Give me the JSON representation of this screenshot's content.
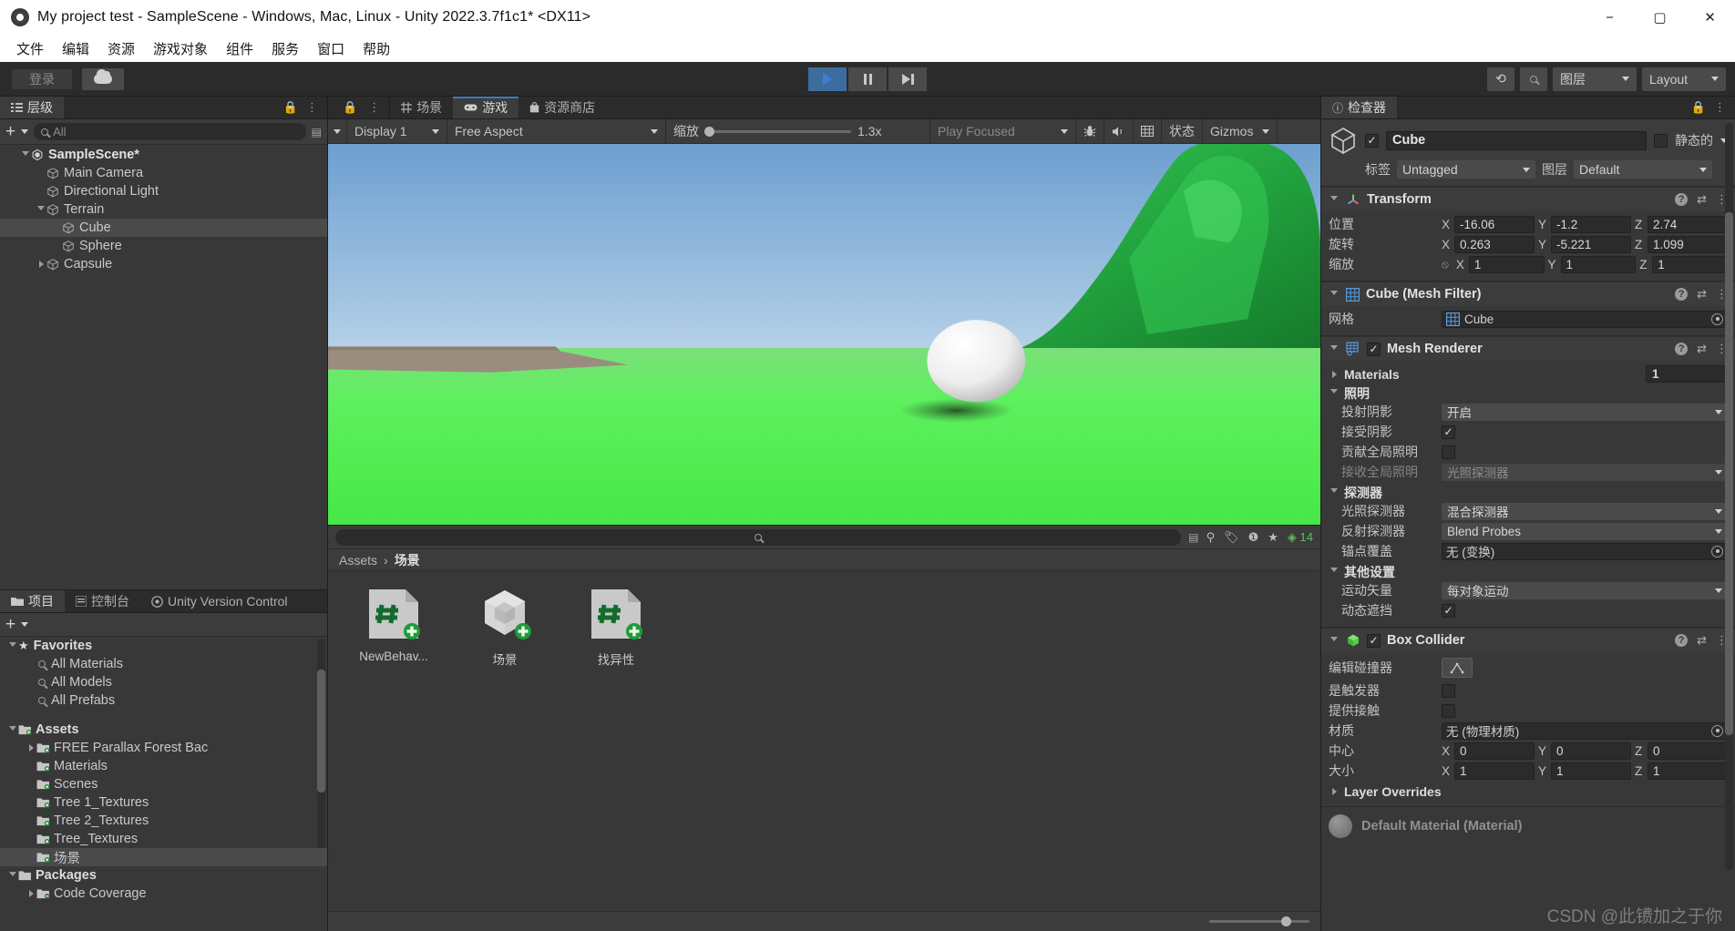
{
  "window": {
    "title": "My project test - SampleScene - Windows, Mac, Linux - Unity 2022.3.7f1c1* <DX11>",
    "app_icon": "unity-logo-icon",
    "minimize": "−",
    "maximize": "▢",
    "close": "✕"
  },
  "menubar": {
    "items": [
      {
        "label": "文件"
      },
      {
        "label": "编辑"
      },
      {
        "label": "资源"
      },
      {
        "label": "游戏对象"
      },
      {
        "label": "组件"
      },
      {
        "label": "服务"
      },
      {
        "label": "窗口"
      },
      {
        "label": "帮助"
      }
    ]
  },
  "toolbar": {
    "login_label": "登录",
    "cloud_icon": "cloud-icon",
    "play_icon": "play-icon",
    "pause_icon": "pause-icon",
    "step_icon": "step-icon",
    "history_icon": "undo-history-icon",
    "search_icon": "search-icon",
    "layers_label": "图层",
    "layout_label": "Layout"
  },
  "hierarchy": {
    "tab_label": "层级",
    "tab_icon": "hierarchy-icon",
    "lock_icon": "lock-icon",
    "menu_icon": "kebab-menu-icon",
    "add_label": "+",
    "search_placeholder": "All",
    "search_icon": "search-icon",
    "items": [
      {
        "label": "SampleScene*",
        "depth": 0,
        "icon": "unity-scene-icon",
        "expanded": true,
        "selected": false,
        "bold": true
      },
      {
        "label": "Main Camera",
        "depth": 1,
        "icon": "gameobject-icon",
        "expanded": null,
        "selected": false,
        "bold": false
      },
      {
        "label": "Directional Light",
        "depth": 1,
        "icon": "gameobject-icon",
        "expanded": null,
        "selected": false,
        "bold": false
      },
      {
        "label": "Terrain",
        "depth": 1,
        "icon": "gameobject-icon",
        "expanded": true,
        "selected": false,
        "bold": false
      },
      {
        "label": "Cube",
        "depth": 2,
        "icon": "gameobject-icon",
        "expanded": null,
        "selected": true,
        "bold": false
      },
      {
        "label": "Sphere",
        "depth": 2,
        "icon": "gameobject-icon",
        "expanded": null,
        "selected": false,
        "bold": false
      },
      {
        "label": "Capsule",
        "depth": 1,
        "icon": "gameobject-icon",
        "expanded": false,
        "selected": false,
        "bold": false
      }
    ]
  },
  "center_tabs": {
    "lock_icon": "lock-icon",
    "menu_icon": "kebab-menu-icon",
    "tabs": [
      {
        "label": "场景",
        "icon": "scene-grid-icon",
        "active": false
      },
      {
        "label": "游戏",
        "icon": "gamepad-icon",
        "active": true
      },
      {
        "label": "资源商店",
        "icon": "asset-store-bag-icon",
        "active": false
      }
    ]
  },
  "game_toolbar": {
    "display": "Display 1",
    "aspect": "Free Aspect",
    "scale_label": "缩放",
    "scale_value": "1.3x",
    "scale_pct": 3,
    "play_focused": "Play Focused",
    "mute_icon": "audio-mute-icon",
    "stats_icon": "stats-icon",
    "bug_icon": "bug-icon",
    "stats_label": "状态",
    "gizmos_label": "Gizmos"
  },
  "project": {
    "tabs": [
      {
        "label": "项目",
        "icon": "folder-icon",
        "active": true
      },
      {
        "label": "控制台",
        "icon": "console-icon",
        "active": false
      },
      {
        "label": "Unity Version Control",
        "icon": "unity-vcs-icon",
        "active": false
      }
    ],
    "lock_icon": "lock-icon",
    "menu_icon": "kebab-menu-icon",
    "add_label": "+",
    "search_placeholder": "",
    "search_icon": "search-icon",
    "filter_icons": [
      "favorite-filter-icon",
      "label-filter-icon",
      "warning-filter-icon",
      "star-filter-icon"
    ],
    "badge_count": "14",
    "tree": [
      {
        "label": "Favorites",
        "depth": 0,
        "icon": "star-icon",
        "expanded": true,
        "bold": true,
        "selected": false
      },
      {
        "label": "All Materials",
        "depth": 1,
        "icon": "search-icon",
        "expanded": null,
        "bold": false,
        "selected": false
      },
      {
        "label": "All Models",
        "depth": 1,
        "icon": "search-icon",
        "expanded": null,
        "bold": false,
        "selected": false
      },
      {
        "label": "All Prefabs",
        "depth": 1,
        "icon": "search-icon",
        "expanded": null,
        "bold": false,
        "selected": false
      },
      {
        "label": "",
        "depth": 0,
        "icon": "spacer",
        "expanded": null,
        "bold": false,
        "selected": false
      },
      {
        "label": "Assets",
        "depth": 0,
        "icon": "folder-plus-icon",
        "expanded": true,
        "bold": true,
        "selected": false
      },
      {
        "label": "FREE Parallax Forest Bac",
        "depth": 1,
        "icon": "folder-plus-icon",
        "expanded": false,
        "bold": false,
        "selected": false
      },
      {
        "label": "Materials",
        "depth": 1,
        "icon": "folder-plus-icon",
        "expanded": null,
        "bold": false,
        "selected": false
      },
      {
        "label": "Scenes",
        "depth": 1,
        "icon": "folder-plus-icon",
        "expanded": null,
        "bold": false,
        "selected": false
      },
      {
        "label": "Tree 1_Textures",
        "depth": 1,
        "icon": "folder-plus-icon",
        "expanded": null,
        "bold": false,
        "selected": false
      },
      {
        "label": "Tree 2_Textures",
        "depth": 1,
        "icon": "folder-plus-icon",
        "expanded": null,
        "bold": false,
        "selected": false
      },
      {
        "label": "Tree_Textures",
        "depth": 1,
        "icon": "folder-plus-icon",
        "expanded": null,
        "bold": false,
        "selected": false
      },
      {
        "label": "场景",
        "depth": 1,
        "icon": "folder-plus-icon",
        "expanded": null,
        "bold": false,
        "selected": true
      },
      {
        "label": "Packages",
        "depth": 0,
        "icon": "folder-icon",
        "expanded": true,
        "bold": true,
        "selected": false
      },
      {
        "label": "Code Coverage",
        "depth": 1,
        "icon": "folder-minus-icon",
        "expanded": false,
        "bold": false,
        "selected": false
      }
    ],
    "breadcrumb": [
      "Assets",
      "场景"
    ],
    "assets": [
      {
        "label": "NewBehav...",
        "icon": "csharp-script-icon"
      },
      {
        "label": "场景",
        "icon": "unity-scene-asset-icon"
      },
      {
        "label": "找异性",
        "icon": "csharp-script-icon"
      }
    ]
  },
  "inspector": {
    "tab_label": "检查器",
    "tab_icon": "info-icon",
    "lock_icon": "lock-icon",
    "menu_icon": "kebab-menu-icon",
    "object_icon": "gameobject-cube-icon",
    "enabled": true,
    "name": "Cube",
    "static_label": "静态的",
    "static_checked": false,
    "tag_label": "标签",
    "tag_value": "Untagged",
    "layer_label": "图层",
    "layer_value": "Default",
    "components": [
      {
        "title": "Transform",
        "icon": "transform-axis-icon",
        "has_checkbox": false,
        "expanded": true,
        "rows": [
          {
            "type": "vec3",
            "label": "位置",
            "x": "-16.06",
            "y": "-1.2",
            "z": "2.74",
            "link": false
          },
          {
            "type": "vec3",
            "label": "旋转",
            "x": "0.263",
            "y": "-5.221",
            "z": "1.099",
            "link": false
          },
          {
            "type": "vec3",
            "label": "缩放",
            "x": "1",
            "y": "1",
            "z": "1",
            "link": true
          }
        ]
      },
      {
        "title": "Cube (Mesh Filter)",
        "icon": "mesh-filter-grid-icon",
        "has_checkbox": false,
        "expanded": true,
        "rows": [
          {
            "type": "object",
            "label": "网格",
            "value": "Cube",
            "value_icon": "mesh-grid-icon"
          }
        ]
      },
      {
        "title": "Mesh Renderer",
        "icon": "mesh-renderer-icon",
        "has_checkbox": true,
        "checked": true,
        "expanded": true,
        "rows": [
          {
            "type": "fold-count",
            "label": "Materials",
            "expanded": false,
            "count": "1"
          },
          {
            "type": "fold",
            "label": "照明",
            "expanded": true
          },
          {
            "type": "dropdown",
            "label": "投射阴影",
            "value": "开启",
            "indent": true
          },
          {
            "type": "checkbox",
            "label": "接受阴影",
            "checked": true,
            "indent": true
          },
          {
            "type": "checkbox",
            "label": "贡献全局照明",
            "checked": false,
            "indent": true
          },
          {
            "type": "dropdown",
            "label": "接收全局照明",
            "value": "光照探测器",
            "indent": true,
            "dimmed": true
          },
          {
            "type": "fold",
            "label": "探测器",
            "expanded": true
          },
          {
            "type": "dropdown",
            "label": "光照探测器",
            "value": "混合探测器",
            "indent": true
          },
          {
            "type": "dropdown",
            "label": "反射探测器",
            "value": "Blend Probes",
            "indent": true
          },
          {
            "type": "object",
            "label": "锚点覆盖",
            "value": "无 (变换)",
            "indent": true
          },
          {
            "type": "fold",
            "label": "其他设置",
            "expanded": true
          },
          {
            "type": "dropdown",
            "label": "运动矢量",
            "value": "每对象运动",
            "indent": true
          },
          {
            "type": "checkbox",
            "label": "动态遮挡",
            "checked": true,
            "indent": true
          }
        ]
      },
      {
        "title": "Box Collider",
        "icon": "box-collider-icon",
        "has_checkbox": true,
        "checked": true,
        "expanded": true,
        "rows": [
          {
            "type": "button",
            "label": "编辑碰撞器",
            "icon": "edit-collider-icon"
          },
          {
            "type": "checkbox",
            "label": "是触发器",
            "checked": false
          },
          {
            "type": "checkbox",
            "label": "提供接触",
            "checked": false
          },
          {
            "type": "object",
            "label": "材质",
            "value": "无 (物理材质)"
          },
          {
            "type": "vec3",
            "label": "中心",
            "x": "0",
            "y": "0",
            "z": "0",
            "link": false
          },
          {
            "type": "vec3",
            "label": "大小",
            "x": "1",
            "y": "1",
            "z": "1",
            "link": false
          },
          {
            "type": "fold",
            "label": "Layer Overrides",
            "expanded": false
          }
        ]
      }
    ],
    "material_preview": "Default Material (Material)"
  },
  "watermark": "CSDN @此镄加之于你",
  "colors": {
    "accent_blue": "#3d7bbf",
    "panel_bg": "#383838",
    "header_bg": "#3c3c3c",
    "selected_row": "#4a4a4a",
    "grass_green": "#5ef05e",
    "sky_blue": "#a8c8e8"
  }
}
